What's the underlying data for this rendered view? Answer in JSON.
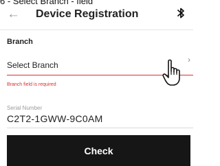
{
  "caption": "6 - Select Branch - field",
  "appbar": {
    "title": "Device Registration",
    "back_icon": "arrow-left-icon",
    "bluetooth_icon": "bluetooth-icon"
  },
  "branch": {
    "section_label": "Branch",
    "select_value": "Select Branch",
    "error": "Branch field is required",
    "chevron_icon": "chevron-right-icon",
    "error_color": "#e02d2d"
  },
  "serial": {
    "label": "Serial Number",
    "value": "C2T2-1GWW-9C0AM"
  },
  "check_button": {
    "label": "Check",
    "background": "#161616"
  },
  "cursor_icon": "hand-pointer-icon"
}
